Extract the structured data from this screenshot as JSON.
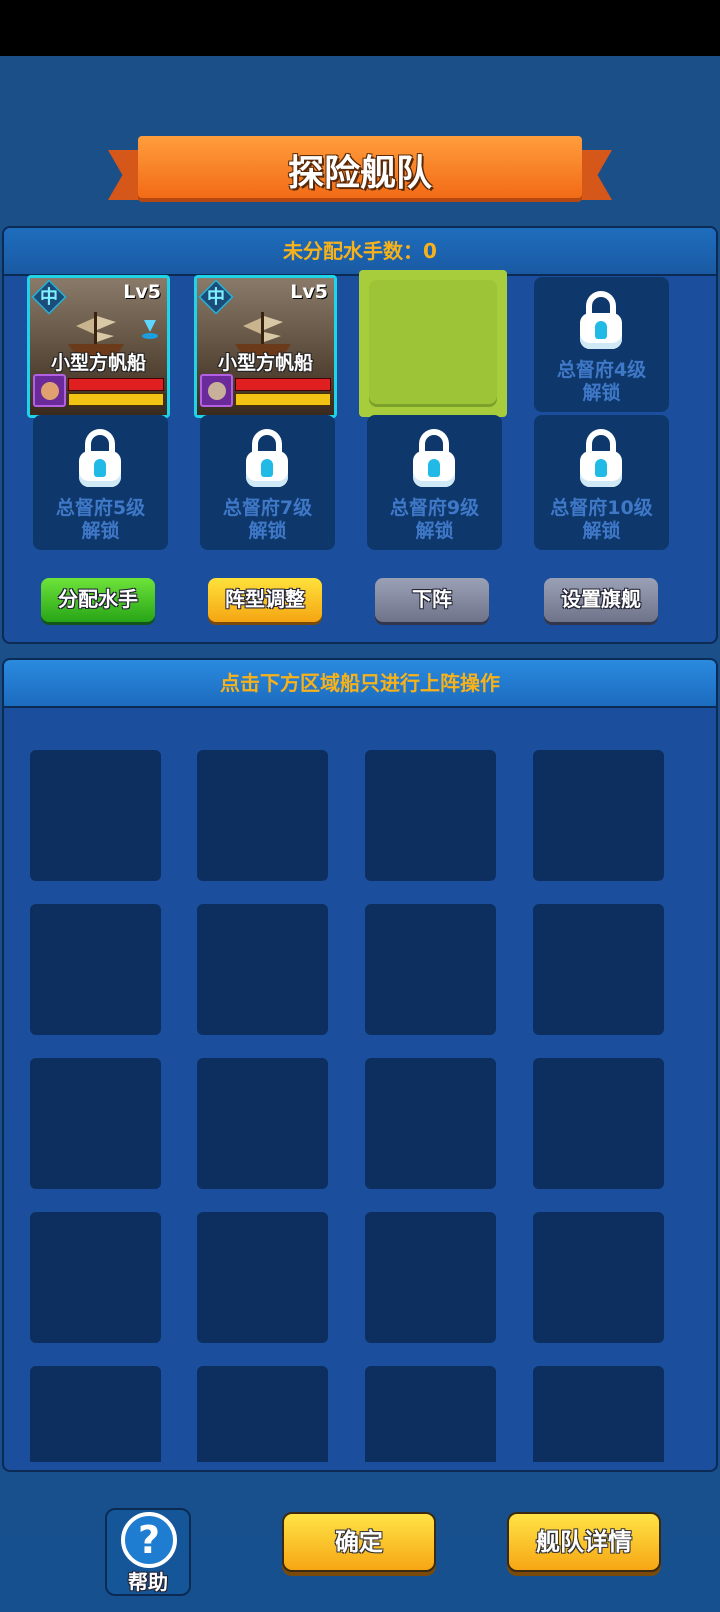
{
  "title": "探险舰队",
  "fleet_panel": {
    "header_label": "未分配水手数：",
    "header_value": "0",
    "ships": [
      {
        "badge": "中",
        "level": "Lv5",
        "name": "小型方帆船"
      },
      {
        "badge": "中",
        "level": "Lv5",
        "name": "小型方帆船"
      }
    ],
    "locked_slots": [
      {
        "line1": "总督府4级",
        "line2": "解锁"
      },
      {
        "line1": "总督府5级",
        "line2": "解锁"
      },
      {
        "line1": "总督府7级",
        "line2": "解锁"
      },
      {
        "line1": "总督府9级",
        "line2": "解锁"
      },
      {
        "line1": "总督府10级",
        "line2": "解锁"
      }
    ],
    "buttons": {
      "assign": "分配水手",
      "formation": "阵型调整",
      "remove": "下阵",
      "flagship": "设置旗舰"
    }
  },
  "ship_panel": {
    "header": "点击下方区域船只进行上阵操作"
  },
  "footer": {
    "help": "帮助",
    "confirm": "确定",
    "details": "舰队详情"
  },
  "icons": {
    "help": "question-mark-icon",
    "lock": "lock-icon"
  },
  "colors": {
    "accent": "#f7b21b",
    "banner": "#f26b16",
    "card_border": "#1fd3e8"
  }
}
